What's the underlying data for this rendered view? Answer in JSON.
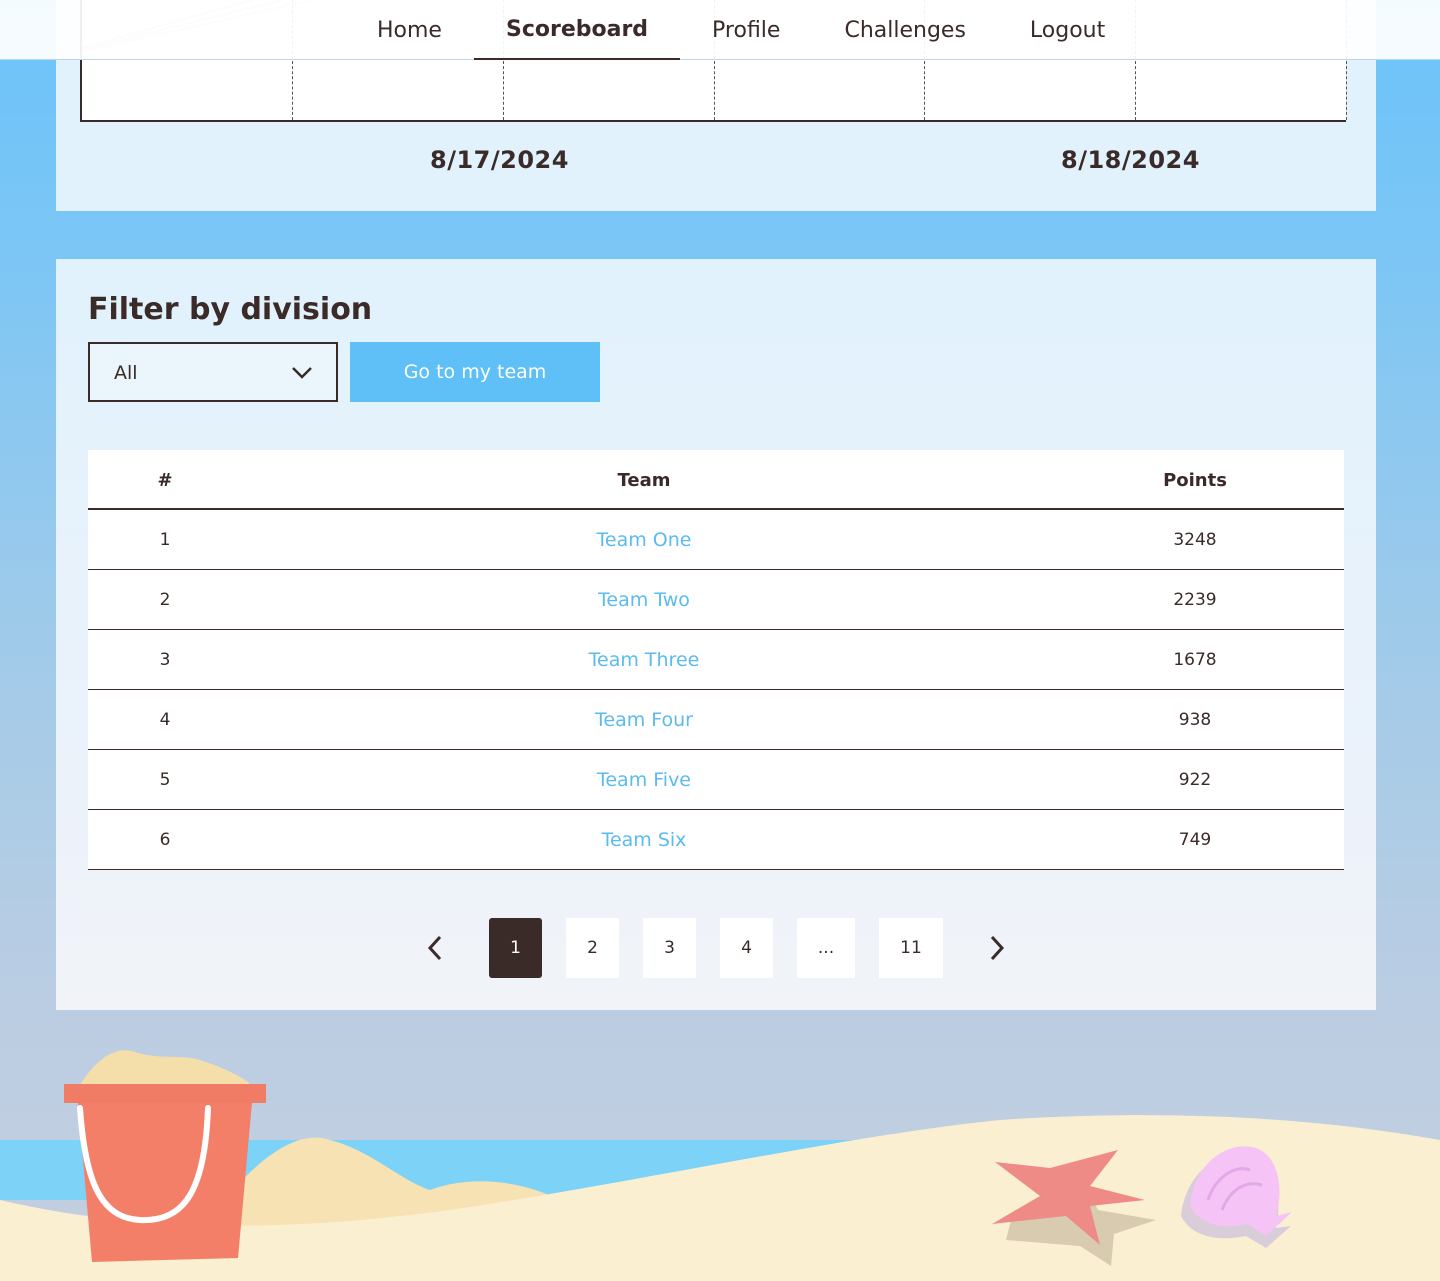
{
  "nav": {
    "items": [
      {
        "label": "Home",
        "active": false
      },
      {
        "label": "Scoreboard",
        "active": true
      },
      {
        "label": "Profile",
        "active": false
      },
      {
        "label": "Challenges",
        "active": false
      },
      {
        "label": "Logout",
        "active": false
      }
    ]
  },
  "chart": {
    "date_labels": [
      "8/17/2024",
      "8/18/2024"
    ]
  },
  "filter": {
    "title": "Filter by division",
    "division_value": "All",
    "go_to_team_label": "Go to my team"
  },
  "table": {
    "headers": {
      "rank": "#",
      "team": "Team",
      "points": "Points"
    },
    "rows": [
      {
        "rank": "1",
        "team": "Team One",
        "points": "3248"
      },
      {
        "rank": "2",
        "team": "Team Two",
        "points": "2239"
      },
      {
        "rank": "3",
        "team": "Team Three",
        "points": "1678"
      },
      {
        "rank": "4",
        "team": "Team Four",
        "points": "938"
      },
      {
        "rank": "5",
        "team": "Team Five",
        "points": "922"
      },
      {
        "rank": "6",
        "team": "Team Six",
        "points": "749"
      }
    ]
  },
  "pagination": {
    "pages": [
      "1",
      "2",
      "3",
      "4",
      "...",
      "11"
    ],
    "current": "1",
    "prev_icon": "chevron-left-icon",
    "next_icon": "chevron-right-icon"
  },
  "colors": {
    "accent": "#5fbff7",
    "link": "#5bbbee",
    "text": "#3a2a28",
    "card": "#e1f2fc"
  }
}
